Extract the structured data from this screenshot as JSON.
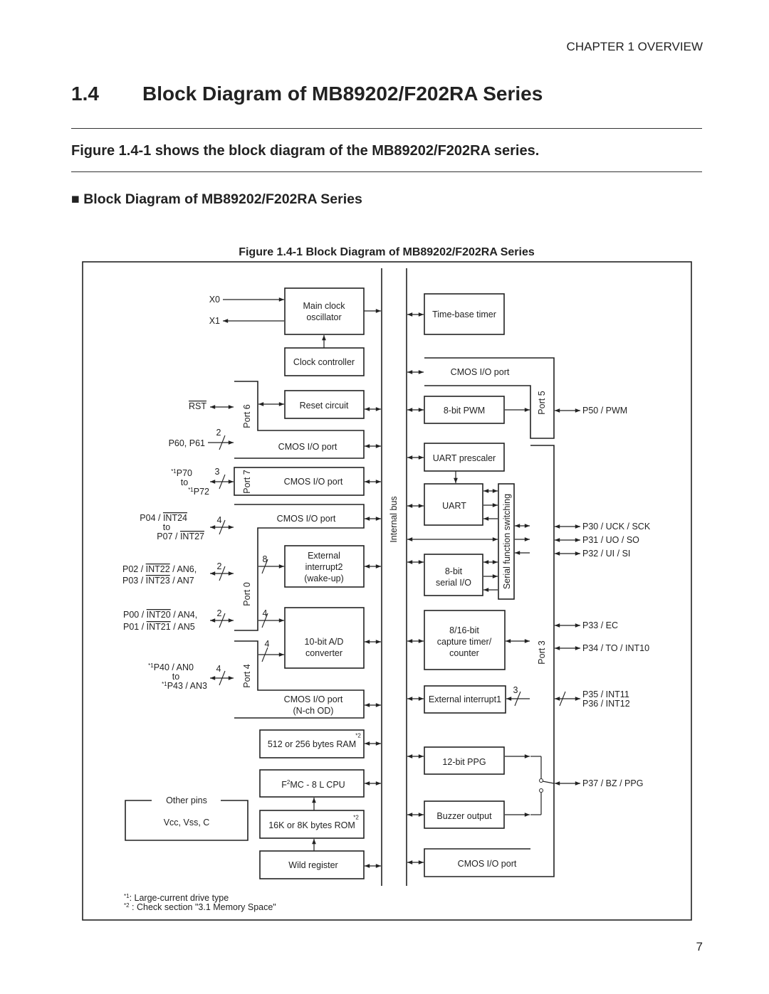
{
  "header": {
    "chapter": "CHAPTER 1  OVERVIEW",
    "section_number": "1.4",
    "section_title": "Block Diagram of MB89202/F202RA Series",
    "summary": "Figure 1.4-1 shows the block diagram of the MB89202/F202RA series.",
    "subheading": "■  Block Diagram of MB89202/F202RA Series",
    "figure_caption": "Figure 1.4-1  Block Diagram of MB89202/F202RA Series",
    "page_number": "7"
  },
  "diagram": {
    "internal_bus": "Internal bus",
    "blocks": {
      "main_clock": [
        "Main clock",
        "oscillator"
      ],
      "clock_controller": "Clock controller",
      "reset_circuit": "Reset circuit",
      "port6_io": "CMOS I/O port",
      "port7_io": "CMOS I/O port",
      "port0_io": "CMOS I/O port",
      "ext_int2": [
        "External",
        "interrupt2",
        "(wake-up)"
      ],
      "adc": [
        "10-bit A/D",
        "converter"
      ],
      "port4_io": [
        "CMOS I/O port",
        "(N-ch OD)"
      ],
      "ram": "512 or 256  bytes RAM",
      "cpu": {
        "pre": "F",
        "sup": "2",
        "post": "MC - 8 L CPU"
      },
      "rom": "16K or 8K bytes ROM",
      "wild_register": "Wild register",
      "other_pins_title": "Other pins",
      "other_pins": "Vcc, Vss, C",
      "time_base_timer": "Time-base timer",
      "port5_io": "CMOS I/O port",
      "pwm": "8-bit PWM",
      "uart_prescaler": "UART prescaler",
      "uart": "UART",
      "serial_switch": "Serial function switching",
      "serial_io": [
        "8-bit",
        "serial I/O"
      ],
      "capture_timer": [
        "8/16-bit",
        "capture timer/",
        "counter"
      ],
      "ext_int1": "External interrupt1",
      "ppg": "12-bit PPG",
      "buzzer": "Buzzer output",
      "port3_io": "CMOS I/O port",
      "mem_note": "*2"
    },
    "ports": {
      "port6": "Port 6",
      "port7": "Port 7",
      "port0": "Port 0",
      "port4": "Port 4",
      "port5": "Port 5",
      "port3": "Port 3"
    },
    "pins_left": {
      "x0": "X0",
      "x1": "X1",
      "rst": "RST",
      "p60": "P60, P61",
      "p70": {
        "star": "*1",
        "text": "P70"
      },
      "p70_to": "to",
      "p72": {
        "star": "*1",
        "text": "P72"
      },
      "p04": {
        "pre": "P04 / ",
        "ov": "INT24",
        "post": ""
      },
      "p04_to": "to",
      "p07": {
        "pre": "P07 / ",
        "ov": "INT27",
        "post": ""
      },
      "p02": {
        "pre": "P02 / ",
        "ov": "INT22",
        "post": " / AN6,"
      },
      "p03": {
        "pre": "P03 / ",
        "ov": "INT23",
        "post": " / AN7"
      },
      "p00": {
        "pre": "P00 / ",
        "ov": "INT20",
        "post": " / AN4,"
      },
      "p01": {
        "pre": "P01 / ",
        "ov": "INT21",
        "post": " / AN5"
      },
      "p40": {
        "star": "*1",
        "text": "P40 / AN0"
      },
      "p40_to": "to",
      "p43": {
        "star": "*1",
        "text": "P43 / AN3"
      }
    },
    "pins_right": {
      "p50": "P50 / PWM",
      "p30": "P30 / UCK / SCK",
      "p31": "P31 / UO / SO",
      "p32": "P32 / UI / SI",
      "p33": "P33 / EC",
      "p34": "P34 / TO / INT10",
      "p35": "P35 / INT11",
      "p36": "P36 / INT12",
      "p37": "P37 / BZ / PPG"
    },
    "bus_widths": {
      "p60": "2",
      "p70": "3",
      "p04": "4",
      "p02": "2",
      "p00": "2",
      "p40": "4",
      "int2": "8",
      "adc0": "4",
      "adc4": "4",
      "int1": "3"
    },
    "footnotes": {
      "n1": {
        "mark": "*1",
        "text": ": Large-current drive type"
      },
      "n2": {
        "mark": "*2",
        "text": " : Check section \"3.1 Memory Space\""
      }
    }
  }
}
